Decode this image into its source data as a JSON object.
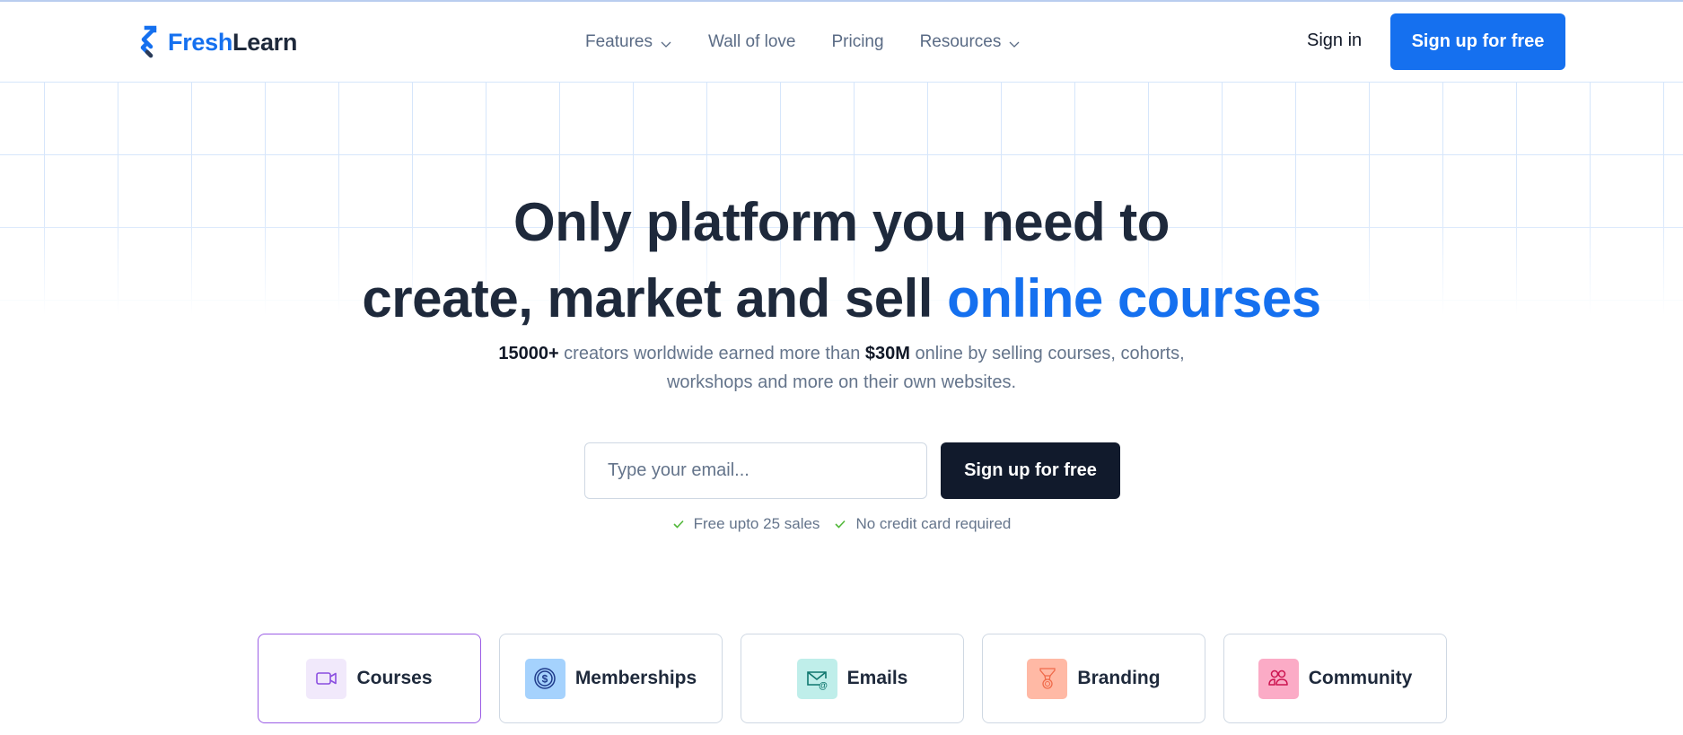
{
  "brand": {
    "name_part1": "Fresh",
    "name_part2": "Learn",
    "accent": "#1570ef"
  },
  "nav": {
    "items": [
      {
        "label": "Features",
        "has_dropdown": true
      },
      {
        "label": "Wall of love",
        "has_dropdown": false
      },
      {
        "label": "Pricing",
        "has_dropdown": false
      },
      {
        "label": "Resources",
        "has_dropdown": true
      }
    ],
    "signin_label": "Sign in",
    "signup_label": "Sign up for free"
  },
  "hero": {
    "title_line1": "Only platform you need to",
    "title_line2_prefix": "create, market and sell ",
    "title_line2_highlight": "online courses",
    "subtitle": {
      "stat1": "15000+",
      "text1": " creators worldwide earned more than ",
      "stat2": "$30M",
      "text2": " online by selling courses, cohorts,",
      "line2": "workshops and more on their own websites."
    },
    "email_placeholder": "Type your email...",
    "email_value": "",
    "signup_label": "Sign up for free",
    "checks": [
      "Free upto 25 sales",
      "No credit card required"
    ]
  },
  "feature_tabs": [
    {
      "label": "Courses",
      "icon": "video-camera-icon",
      "active": true,
      "bg": "#f1e9fb",
      "fg": "#8b4fe0"
    },
    {
      "label": "Memberships",
      "icon": "dollar-coin-icon",
      "active": false,
      "bg": "#a5d2fd",
      "fg": "#1e3a8a"
    },
    {
      "label": "Emails",
      "icon": "email-at-icon",
      "active": false,
      "bg": "#bfeeea",
      "fg": "#0f766e"
    },
    {
      "label": "Branding",
      "icon": "medal-icon",
      "active": false,
      "bg": "#ffb9a5",
      "fg": "#f06a4a"
    },
    {
      "label": "Community",
      "icon": "users-icon",
      "active": false,
      "bg": "#fbabc6",
      "fg": "#cc1450"
    }
  ]
}
